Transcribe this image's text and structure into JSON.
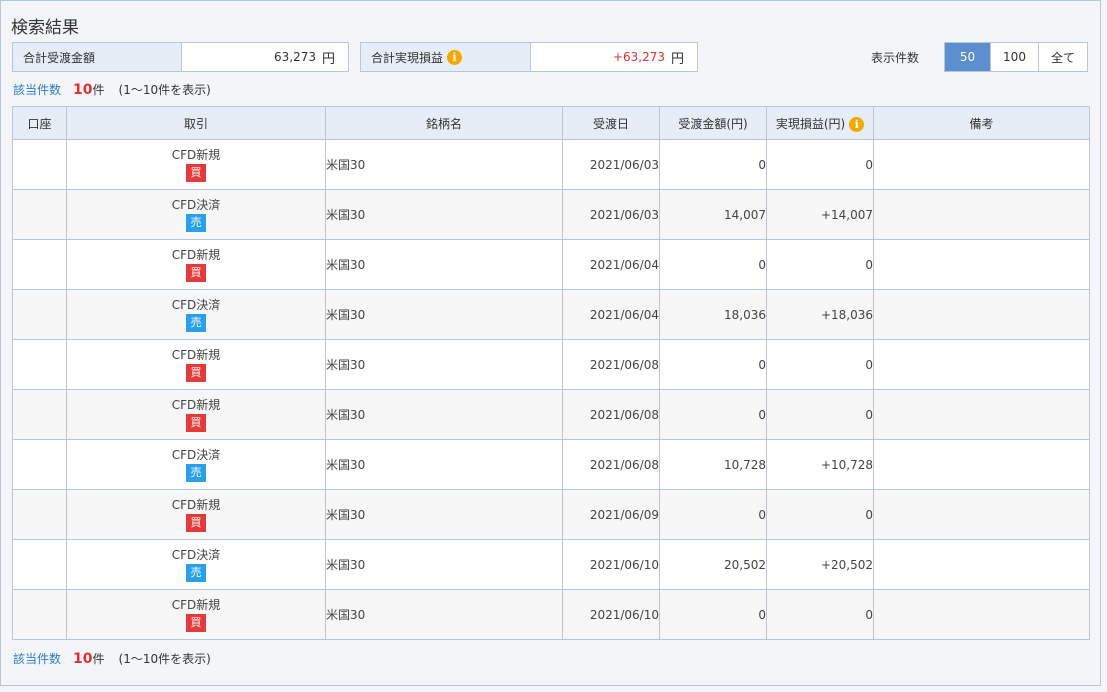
{
  "page": {
    "title": "検索結果",
    "total_received_label": "合計受渡金額",
    "total_received_value": "63,273",
    "total_received_unit": "円",
    "total_profit_label": "合計実現損益",
    "total_profit_value": "+63,273",
    "total_profit_unit": "円",
    "info_glyph": "i",
    "per_page_label": "表示件数",
    "per_page_options": [
      "50",
      "100",
      "全て"
    ],
    "per_page_selected": "50"
  },
  "count": {
    "link": "該当件数",
    "num": "10",
    "unit": "件",
    "range": "(1～10件を表示)"
  },
  "table": {
    "headers": {
      "account": "口座",
      "trade": "取引",
      "name": "銘柄名",
      "date": "受渡日",
      "amount": "受渡金額(円)",
      "profit": "実現損益(円)",
      "remarks": "備考"
    },
    "rows": [
      {
        "trade": "CFD新規",
        "side": "買",
        "name": "米国30",
        "date": "2021/06/03",
        "amount": "0",
        "profit": "0"
      },
      {
        "trade": "CFD決済",
        "side": "売",
        "name": "米国30",
        "date": "2021/06/03",
        "amount": "14,007",
        "profit": "+14,007"
      },
      {
        "trade": "CFD新規",
        "side": "買",
        "name": "米国30",
        "date": "2021/06/04",
        "amount": "0",
        "profit": "0"
      },
      {
        "trade": "CFD決済",
        "side": "売",
        "name": "米国30",
        "date": "2021/06/04",
        "amount": "18,036",
        "profit": "+18,036"
      },
      {
        "trade": "CFD新規",
        "side": "買",
        "name": "米国30",
        "date": "2021/06/08",
        "amount": "0",
        "profit": "0"
      },
      {
        "trade": "CFD新規",
        "side": "買",
        "name": "米国30",
        "date": "2021/06/08",
        "amount": "0",
        "profit": "0"
      },
      {
        "trade": "CFD決済",
        "side": "売",
        "name": "米国30",
        "date": "2021/06/08",
        "amount": "10,728",
        "profit": "+10,728"
      },
      {
        "trade": "CFD新規",
        "side": "買",
        "name": "米国30",
        "date": "2021/06/09",
        "amount": "0",
        "profit": "0"
      },
      {
        "trade": "CFD決済",
        "side": "売",
        "name": "米国30",
        "date": "2021/06/10",
        "amount": "20,502",
        "profit": "+20,502"
      },
      {
        "trade": "CFD新規",
        "side": "買",
        "name": "米国30",
        "date": "2021/06/10",
        "amount": "0",
        "profit": "0"
      }
    ]
  },
  "colors": {
    "accent": "#5b8fcf",
    "positive": "#e03030",
    "buy": "#e53a3a",
    "sell": "#2aa0e8",
    "info": "#f5a800",
    "link": "#2a7fc9"
  }
}
